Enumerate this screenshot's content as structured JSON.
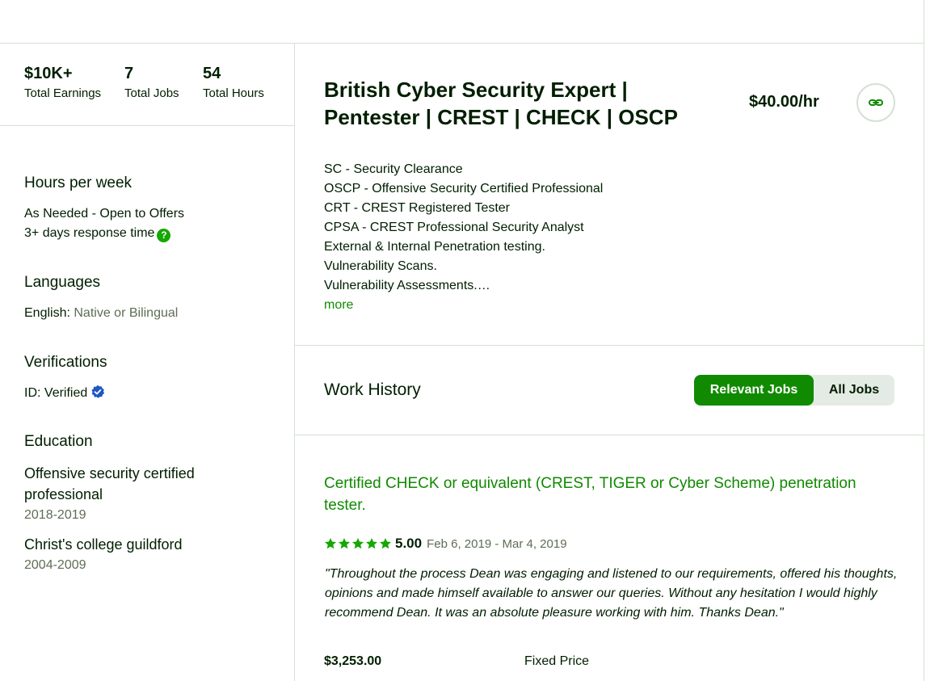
{
  "stats": [
    {
      "value": "$10K+",
      "label": "Total Earnings"
    },
    {
      "value": "7",
      "label": "Total Jobs"
    },
    {
      "value": "54",
      "label": "Total Hours"
    }
  ],
  "hours": {
    "title": "Hours per week",
    "availability": "As Needed - Open to Offers",
    "response_time": "3+ days response time",
    "help_glyph": "?"
  },
  "languages": {
    "title": "Languages",
    "items": [
      {
        "name": "English:",
        "level": "Native or Bilingual"
      }
    ]
  },
  "verifications": {
    "title": "Verifications",
    "id_label": "ID:",
    "id_status": "Verified"
  },
  "education": {
    "title": "Education",
    "items": [
      {
        "school": "Offensive security certified professional",
        "years": "2018-2019"
      },
      {
        "school": "Christ's college guildford",
        "years": "2004-2009"
      }
    ]
  },
  "profile": {
    "title": "British Cyber Security Expert | Pentester | CREST | CHECK | OSCP",
    "rate": "$40.00/hr",
    "overview": [
      "SC - Security Clearance",
      "OSCP - Offensive Security Certified Professional",
      "CRT - CREST Registered Tester",
      "CPSA - CREST Professional Security Analyst",
      "External & Internal Penetration testing.",
      "Vulnerability Scans.",
      "Vulnerability Assessments.…"
    ],
    "more_label": "more"
  },
  "work_history": {
    "title": "Work History",
    "tabs": [
      {
        "label": "Relevant Jobs",
        "active": true
      },
      {
        "label": "All Jobs",
        "active": false
      }
    ],
    "jobs": [
      {
        "title": "Certified CHECK or equivalent (CREST, TIGER or Cyber Scheme) penetration tester.",
        "stars": 5,
        "rating": "5.00",
        "dates": "Feb 6, 2019 - Mar 4, 2019",
        "feedback": "\"Throughout the process Dean was engaging and listened to our requirements, offered his thoughts, opinions and made himself available to answer our queries. Without any hesitation I would highly recommend Dean. It was an absolute pleasure working with him. Thanks Dean.\"",
        "price": "$3,253.00",
        "price_type": "Fixed Price"
      }
    ]
  },
  "colors": {
    "accent": "#108a00",
    "star": "#14a800",
    "verified": "#1f57c3",
    "border": "#d5e0d5",
    "text": "#001e00",
    "muted": "#5e6d55"
  },
  "icons": {
    "link": "link-icon",
    "help": "help-icon",
    "verified": "verified-badge-icon",
    "star": "star-icon"
  }
}
